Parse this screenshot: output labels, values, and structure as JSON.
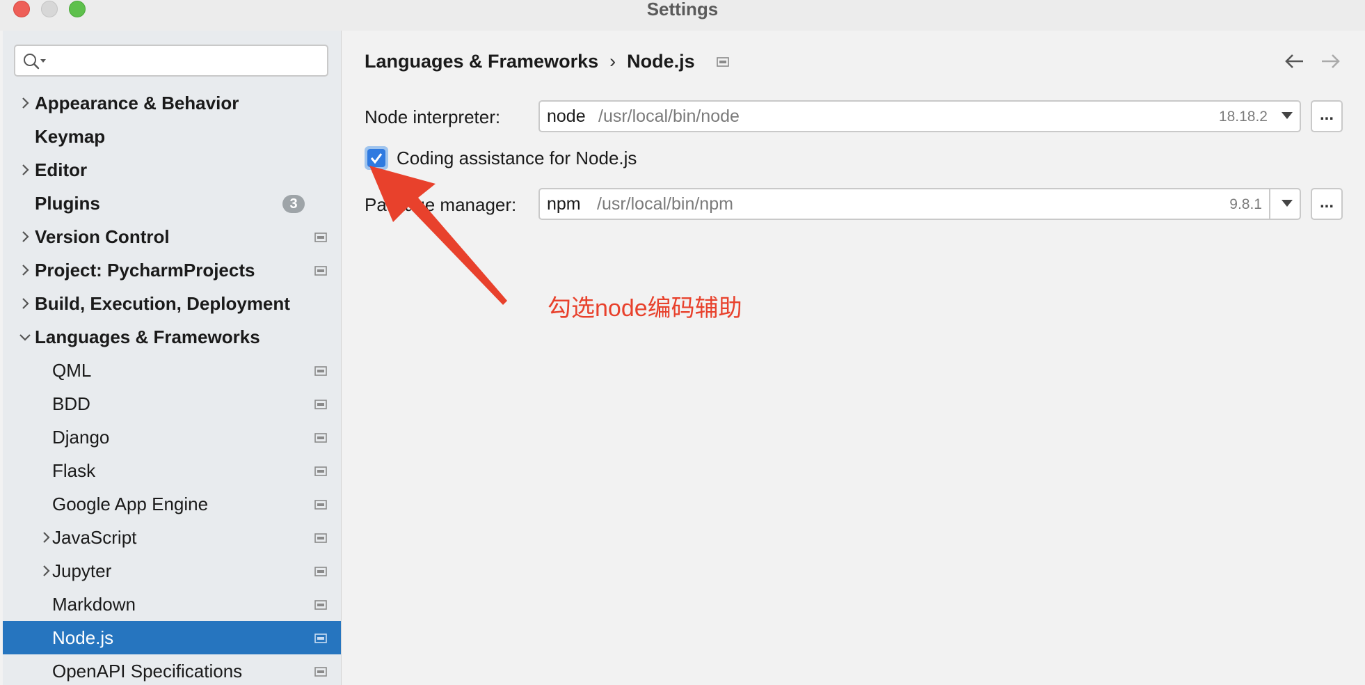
{
  "window": {
    "title": "Settings"
  },
  "search": {
    "placeholder": ""
  },
  "sidebar": {
    "items": [
      {
        "label": "Appearance & Behavior"
      },
      {
        "label": "Keymap"
      },
      {
        "label": "Editor"
      },
      {
        "label": "Plugins",
        "badge": "3"
      },
      {
        "label": "Version Control"
      },
      {
        "label": "Project: PycharmProjects"
      },
      {
        "label": "Build, Execution, Deployment"
      },
      {
        "label": "Languages & Frameworks"
      },
      {
        "label": "QML"
      },
      {
        "label": "BDD"
      },
      {
        "label": "Django"
      },
      {
        "label": "Flask"
      },
      {
        "label": "Google App Engine"
      },
      {
        "label": "JavaScript"
      },
      {
        "label": "Jupyter"
      },
      {
        "label": "Markdown"
      },
      {
        "label": "Node.js",
        "selected": true
      },
      {
        "label": "OpenAPI Specifications"
      }
    ]
  },
  "breadcrumb": {
    "parent": "Languages & Frameworks",
    "separator": "›",
    "current": "Node.js"
  },
  "node_interpreter": {
    "label": "Node interpreter:",
    "value": "node",
    "path": "/usr/local/bin/node",
    "version": "18.18.2",
    "more": "..."
  },
  "coding_assistance": {
    "label": "Coding assistance for Node.js",
    "checked": true
  },
  "package_manager": {
    "label": "Package manager:",
    "value": "npm",
    "path": "/usr/local/bin/npm",
    "version": "9.8.1",
    "more": "..."
  },
  "annotation": {
    "text": "勾选node编码辅助",
    "color": "#e8412c"
  },
  "colors": {
    "selection": "#2675bf",
    "checkbox": "#2f7ae0",
    "annotation_arrow": "#e8412c"
  }
}
